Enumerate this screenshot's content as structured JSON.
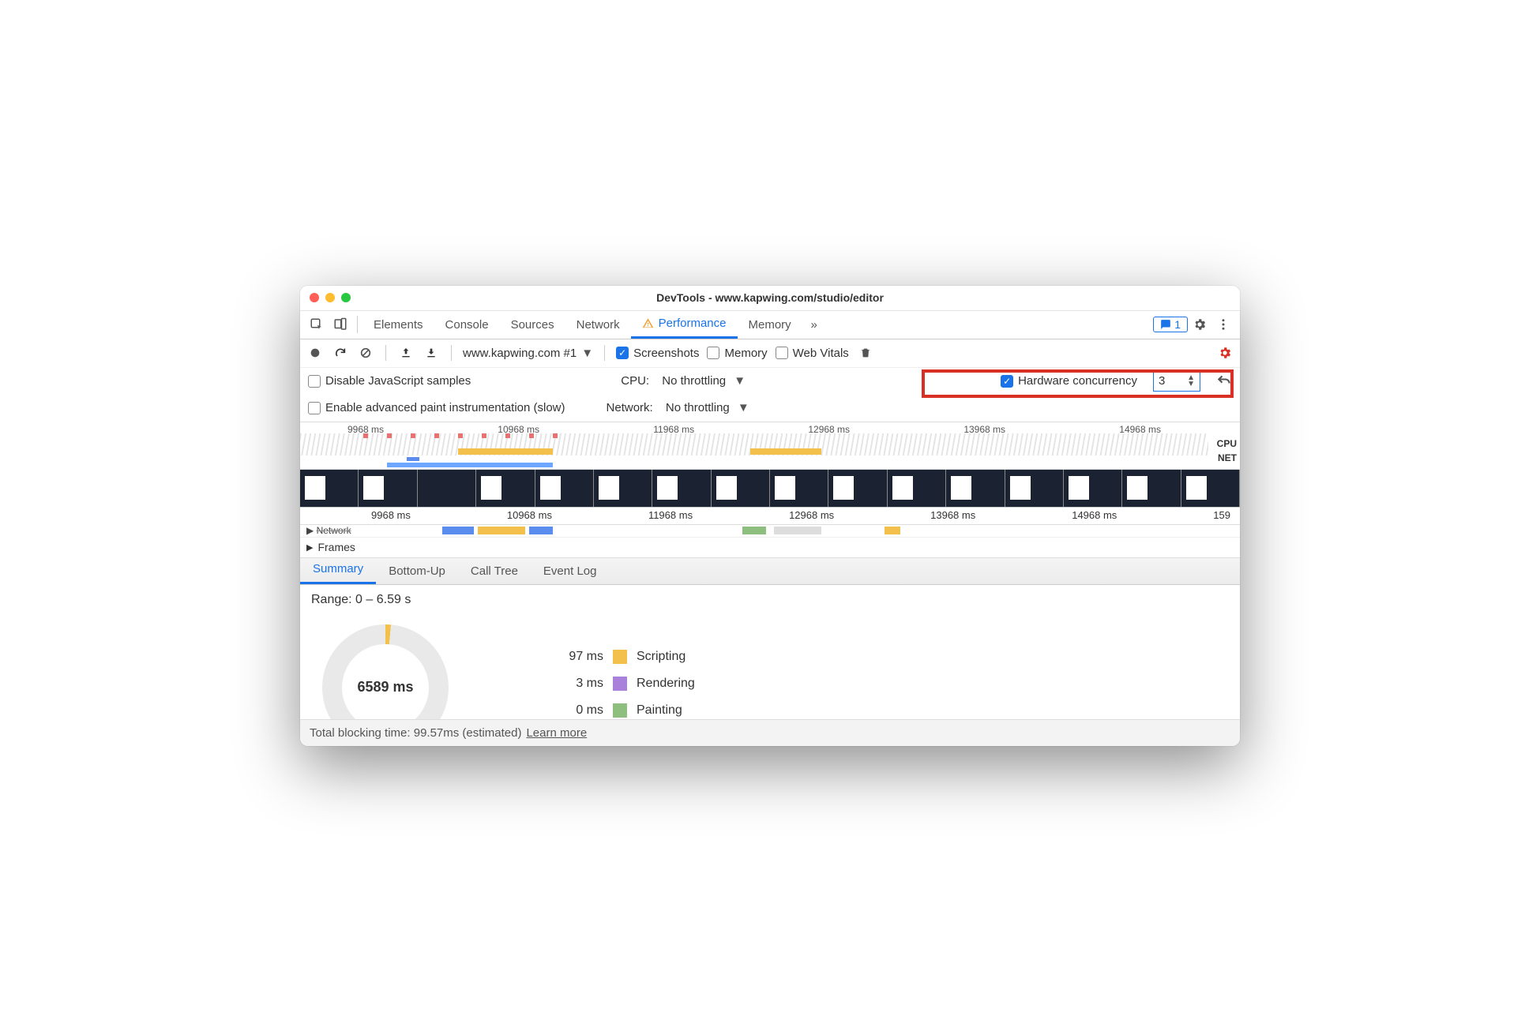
{
  "window": {
    "title": "DevTools - www.kapwing.com/studio/editor"
  },
  "tabs": {
    "items": [
      "Elements",
      "Console",
      "Sources",
      "Network",
      "Performance",
      "Memory"
    ],
    "active": "Performance",
    "warning_on": "Performance",
    "more_glyph": "»",
    "feedback_count": "1"
  },
  "toolbar": {
    "target": "www.kapwing.com #1",
    "screenshots": {
      "checked": true,
      "label": "Screenshots"
    },
    "memory": {
      "checked": false,
      "label": "Memory"
    },
    "webvitals": {
      "checked": false,
      "label": "Web Vitals"
    }
  },
  "options": {
    "disable_js": {
      "checked": false,
      "label": "Disable JavaScript samples"
    },
    "cpu": {
      "label": "CPU:",
      "value": "No throttling"
    },
    "hardware": {
      "checked": true,
      "label": "Hardware concurrency",
      "value": "3"
    },
    "paint": {
      "checked": false,
      "label": "Enable advanced paint instrumentation (slow)"
    },
    "network": {
      "label": "Network:",
      "value": "No throttling"
    }
  },
  "overview": {
    "ticks": [
      "9968 ms",
      "10968 ms",
      "11968 ms",
      "12968 ms",
      "13968 ms",
      "14968 ms"
    ],
    "right_labels": [
      "CPU",
      "NET"
    ]
  },
  "ruler2": {
    "ticks": [
      "9968 ms",
      "10968 ms",
      "11968 ms",
      "12968 ms",
      "13968 ms",
      "14968 ms",
      "159"
    ]
  },
  "tracks": {
    "network_label": "Network",
    "frames_label": "Frames"
  },
  "summary_tabs": [
    "Summary",
    "Bottom-Up",
    "Call Tree",
    "Event Log"
  ],
  "summary_active": "Summary",
  "summary": {
    "range": "Range: 0 – 6.59 s",
    "total": "6589 ms",
    "legend": [
      {
        "ms": "97 ms",
        "label": "Scripting",
        "color": "#f3c14b"
      },
      {
        "ms": "3 ms",
        "label": "Rendering",
        "color": "#a980da"
      },
      {
        "ms": "0 ms",
        "label": "Painting",
        "color": "#8fbf7f"
      }
    ]
  },
  "footer": {
    "text": "Total blocking time: 99.57ms (estimated)",
    "link": "Learn more"
  }
}
